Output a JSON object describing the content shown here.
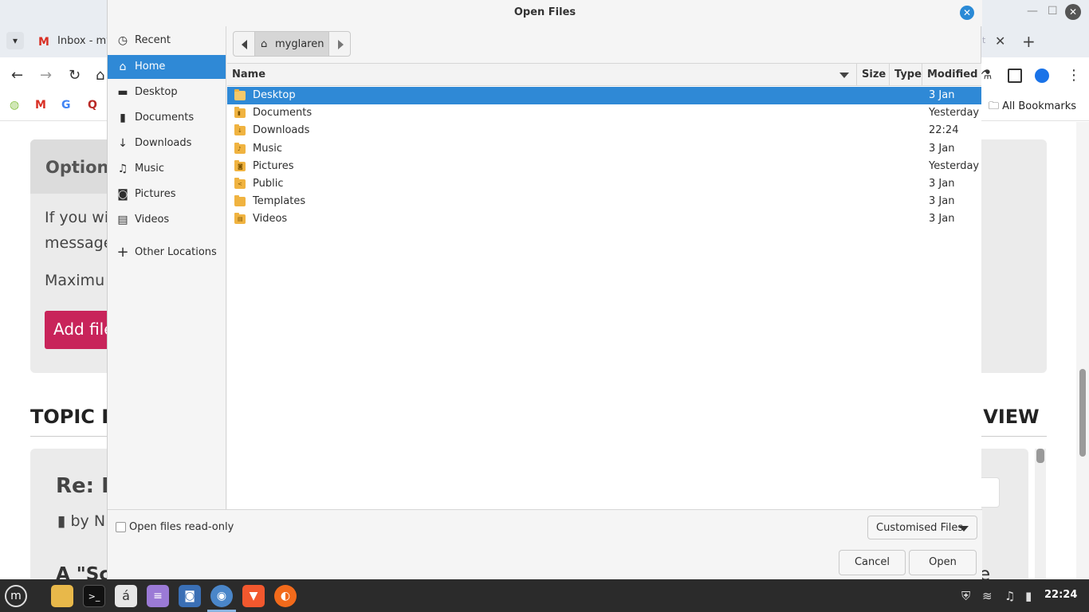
{
  "browser": {
    "tab_title": "Inbox - my",
    "tab_icon": "gmail-icon",
    "all_bookmarks": "All Bookmarks",
    "page": {
      "options": "Options",
      "text_line1": "If you wi",
      "text_line2": "message",
      "maximum": "Maximu",
      "add_file": "Add file",
      "topic_left": "TOPIC R",
      "topic_right": "D VIEW",
      "post_title": "Re: F",
      "post_by": "by N",
      "quote_left": "A \"Sc",
      "quote_right": "e"
    }
  },
  "dialog": {
    "title": "Open Files",
    "sidebar": {
      "items": [
        {
          "label": "Recent",
          "icon": "clock-icon"
        },
        {
          "label": "Home",
          "icon": "home-icon",
          "active": true
        },
        {
          "label": "Desktop",
          "icon": "desktop-icon"
        },
        {
          "label": "Documents",
          "icon": "document-icon"
        },
        {
          "label": "Downloads",
          "icon": "download-icon"
        },
        {
          "label": "Music",
          "icon": "music-icon"
        },
        {
          "label": "Pictures",
          "icon": "camera-icon"
        },
        {
          "label": "Videos",
          "icon": "film-icon"
        },
        {
          "label": "Other Locations",
          "icon": "plus-icon"
        }
      ]
    },
    "path": {
      "current": "myglaren"
    },
    "columns": {
      "name": "Name",
      "size": "Size",
      "type": "Type",
      "modified": "Modified"
    },
    "files": [
      {
        "name": "Desktop",
        "modified": "3 Jan",
        "selected": true
      },
      {
        "name": "Documents",
        "modified": "Yesterday"
      },
      {
        "name": "Downloads",
        "modified": "22:24"
      },
      {
        "name": "Music",
        "modified": "3 Jan"
      },
      {
        "name": "Pictures",
        "modified": "Yesterday"
      },
      {
        "name": "Public",
        "modified": "3 Jan"
      },
      {
        "name": "Templates",
        "modified": "3 Jan"
      },
      {
        "name": "Videos",
        "modified": "3 Jan"
      }
    ],
    "read_only_label": "Open files read-only",
    "filter_label": "Customised Files",
    "cancel_label": "Cancel",
    "open_label": "Open"
  },
  "taskbar": {
    "clock": "22:24"
  },
  "colors": {
    "selection": "#2f89d6",
    "folder": "#f0b340",
    "taskbar": "#2b2b2b",
    "add_file_button": "#c8245a"
  }
}
